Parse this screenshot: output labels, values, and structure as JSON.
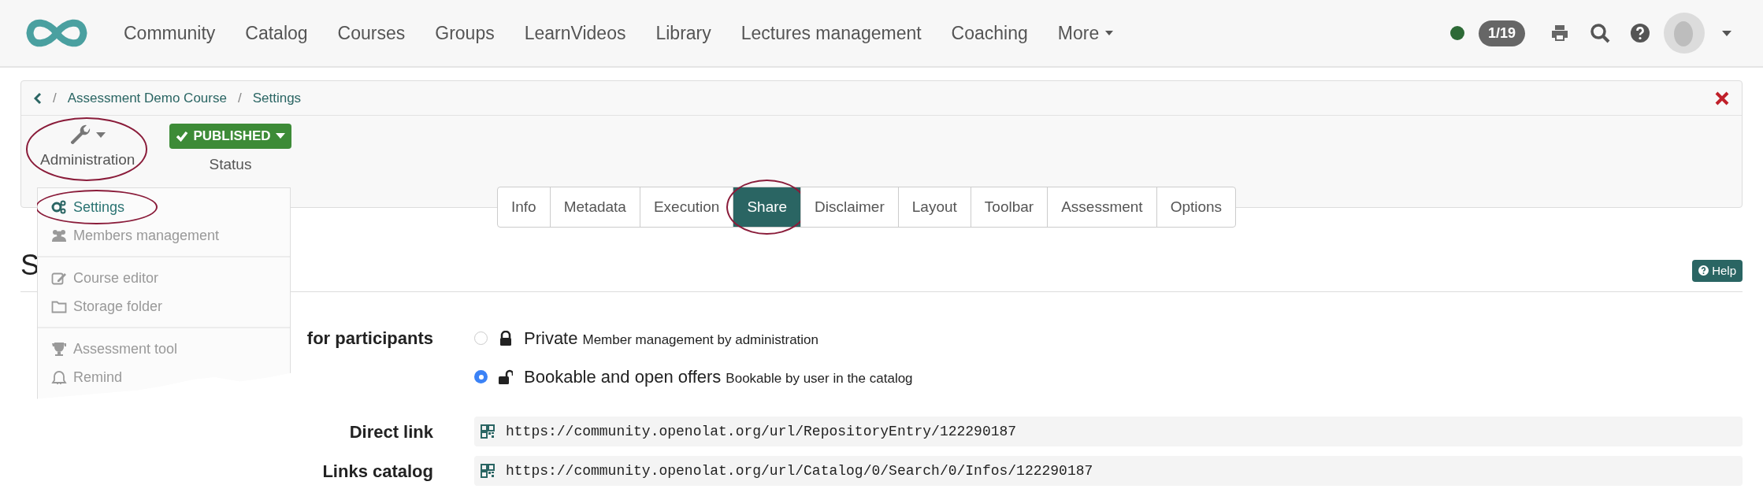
{
  "nav": {
    "items": [
      "Community",
      "Catalog",
      "Courses",
      "Groups",
      "LearnVideos",
      "Library",
      "Lectures management",
      "Coaching",
      "More"
    ],
    "counter": "1/19"
  },
  "breadcrumb": {
    "separator": "/",
    "items": [
      "Assessment Demo Course",
      "Settings"
    ]
  },
  "toolbar": {
    "administration": {
      "label": "Administration",
      "highlighted": true
    },
    "status": {
      "badge": "PUBLISHED",
      "label": "Status"
    }
  },
  "tabs": [
    {
      "label": "Info",
      "selected": false,
      "highlighted": false
    },
    {
      "label": "Metadata",
      "selected": false,
      "highlighted": false
    },
    {
      "label": "Execution",
      "selected": false,
      "highlighted": false
    },
    {
      "label": "Share",
      "selected": true,
      "highlighted": true
    },
    {
      "label": "Disclaimer",
      "selected": false,
      "highlighted": false
    },
    {
      "label": "Layout",
      "selected": false,
      "highlighted": false
    },
    {
      "label": "Toolbar",
      "selected": false,
      "highlighted": false
    },
    {
      "label": "Assessment",
      "selected": false,
      "highlighted": false
    },
    {
      "label": "Options",
      "selected": false,
      "highlighted": false
    }
  ],
  "menu": {
    "groups": [
      [
        {
          "label": "Settings",
          "active": true,
          "highlighted": true
        },
        {
          "label": "Members management",
          "active": false,
          "highlighted": false
        }
      ],
      [
        {
          "label": "Course editor",
          "active": false,
          "highlighted": false
        },
        {
          "label": "Storage folder",
          "active": false,
          "highlighted": false
        }
      ],
      [
        {
          "label": "Assessment tool",
          "active": false,
          "highlighted": false
        },
        {
          "label": "Remind",
          "active": false,
          "highlighted": false
        }
      ]
    ]
  },
  "page": {
    "heading": "S",
    "help": "Help",
    "access": {
      "label": "for participants",
      "options": [
        {
          "title": "Private",
          "description": "Member management by administration",
          "selected": false
        },
        {
          "title": "Bookable and open offers",
          "description": "Bookable by user in the catalog",
          "selected": true
        }
      ]
    },
    "links": [
      {
        "label": "Direct link",
        "url": "https://community.openolat.org/url/RepositoryEntry/122290187"
      },
      {
        "label": "Links catalog",
        "url": "https://community.openolat.org/url/Catalog/0/Search/0/Infos/122290187"
      }
    ]
  }
}
